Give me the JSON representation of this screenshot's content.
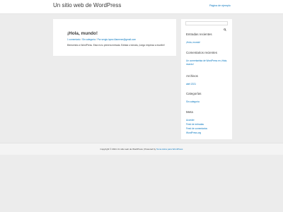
{
  "header": {
    "site_title": "Un sitio web de WordPress",
    "nav_link": "Página de ejemplo"
  },
  "post": {
    "title": "¡Hola, mundo!",
    "meta": {
      "comments": "1 comentario",
      "category": "Sin categoría",
      "author": "Por sergio.lopez.illamenm@gmail.com"
    },
    "excerpt": "Bienvenido a WordPress. Esta es tu primera entrada. Edítala o bórrala, ¡luego empieza a escribir!"
  },
  "sidebar": {
    "search": {
      "placeholder": "",
      "value": ""
    },
    "recent_posts": {
      "title": "Entradas recientes",
      "items": [
        "¡Hola, mundo!"
      ]
    },
    "recent_comments": {
      "title": "Comentarios recientes",
      "line1": "Un comentarista de WordPress en ¡Hola,",
      "line2": "mundo!"
    },
    "archives": {
      "title": "Archivos",
      "items": [
        "abril 2021"
      ]
    },
    "categories": {
      "title": "Categorías",
      "items": [
        "Sin categoría"
      ]
    },
    "meta": {
      "title": "Meta",
      "items": [
        "Acceder",
        "Feed de entradas",
        "Feed de comentarios",
        "WordPress.org"
      ]
    }
  },
  "footer": {
    "copyright": "Copyright © 2021 Un sitio web de WordPress | Powered by",
    "theme_link": "Tema Astra para WordPress"
  },
  "colors": {
    "accent": "#0274be",
    "text": "#3a3a3a",
    "background": "#ececec",
    "panel": "#ffffff"
  },
  "icons": {
    "search": "search-icon"
  }
}
